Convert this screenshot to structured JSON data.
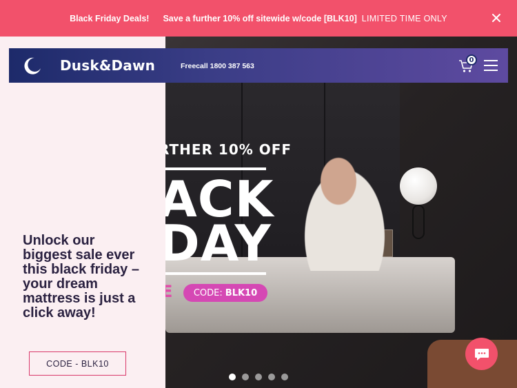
{
  "promo": {
    "deals_label": "Black Friday Deals!",
    "save_text": "Save a further 10% off sitewide w/code [BLK10]",
    "limited_text": "LIMITED TIME ONLY",
    "close_icon": "close-icon"
  },
  "header": {
    "brand": "Dusk&Dawn",
    "logo_icon": "moon-icon",
    "freecall": "Freecall 1800 387 563",
    "cart_count": "0",
    "cart_icon": "cart-icon",
    "menu_icon": "hamburger-menu-icon"
  },
  "hero": {
    "further_text": "RTHER 10% OFF",
    "line1": "ACK",
    "line2": "DAY",
    "fragment": "E",
    "code_label": "CODE:",
    "code_value": "BLK10",
    "slide_count": 5,
    "active_slide": 1
  },
  "side": {
    "headline": "Unlock our biggest sale ever this black friday – your dream mattress is just a click away!",
    "button_label": "CODE - BLK10"
  },
  "chat": {
    "icon": "chat-bubble-icon"
  },
  "colors": {
    "promo_bg": "#f2516b",
    "header_start": "#1d2a6a",
    "header_end": "#5e4aa0",
    "accent_pink": "#d548b4",
    "side_bg": "#fbeff2"
  }
}
